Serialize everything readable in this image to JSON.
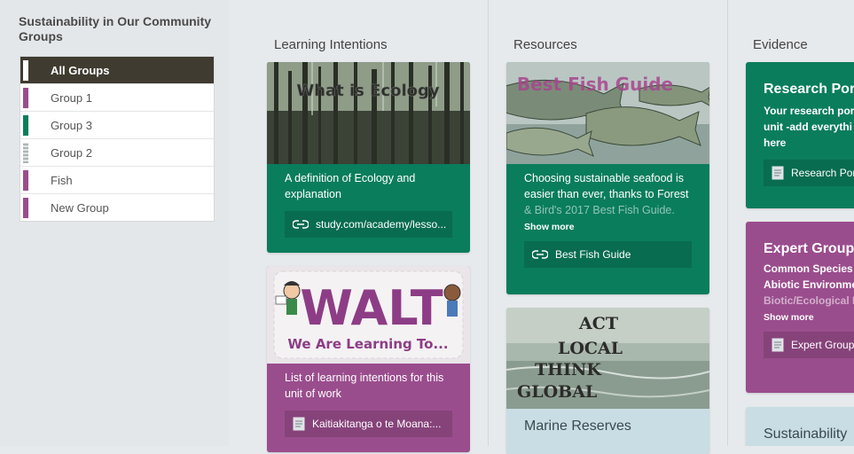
{
  "sidebar": {
    "title": "Sustainability in Our Community Groups",
    "groups": [
      {
        "label": "All Groups",
        "color": "#3f3b30"
      },
      {
        "label": "Group 1",
        "color": "#9a4d8d"
      },
      {
        "label": "Group 3",
        "color": "#0a7d5c"
      },
      {
        "label": "Group 2",
        "color": "#b8c2c4"
      },
      {
        "label": "Fish",
        "color": "#9a4d8d"
      },
      {
        "label": "New Group",
        "color": "#9a4d8d"
      }
    ]
  },
  "columns": {
    "learning": {
      "title": "Learning Intentions",
      "card1": {
        "image_text": "What is Ecology",
        "description": "A definition of Ecology and explanation",
        "link": "study.com/academy/lesso..."
      },
      "card2": {
        "image_title": "WALT",
        "image_subtitle": "We Are Learning To...",
        "description": "List of learning intentions for this unit of work",
        "link": "Kaitiakitanga o te Moana:..."
      }
    },
    "resources": {
      "title": "Resources",
      "card1": {
        "image_text": "Best Fish Guide",
        "description_line1": "Choosing sustainable seafood is",
        "description_line2": "easier than ever, thanks to Forest",
        "description_line3": "& Bird's 2017 Best Fish Guide.",
        "show_more": "Show more",
        "link": "Best Fish Guide"
      },
      "card2": {
        "image_lines": [
          "ACT",
          "LOCAL",
          "THINK",
          "GLOBAL"
        ],
        "title": "Marine Reserves"
      }
    },
    "evidence": {
      "title": "Evidence",
      "card1": {
        "title": "Research Por",
        "text1": "Your research por",
        "text2": "unit -add everythi",
        "text3": "here",
        "link": "Research Por"
      },
      "card2": {
        "title": "Expert Group",
        "text1": "Common Species T",
        "text2": "Abiotic Environme",
        "text3": "Biotic/Ecological In",
        "show_more": "Show more",
        "link": "Expert Group"
      },
      "card3": {
        "title": "Sustainability"
      }
    }
  },
  "colors": {
    "green": "#0a7d5c",
    "purple": "#9a4d8d",
    "dark": "#3f3b30",
    "light_blue": "#c9dde4"
  }
}
